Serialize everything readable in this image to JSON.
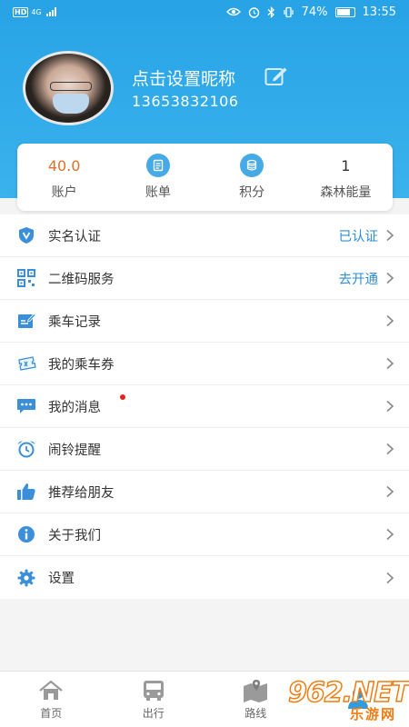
{
  "status_bar": {
    "network_hd": "HD",
    "network_gen": "4G",
    "battery": "74%",
    "time": "13:55"
  },
  "profile": {
    "nickname": "点击设置昵称",
    "phone": "13653832106"
  },
  "stats": [
    {
      "value": "40.0",
      "label": "账户",
      "icon": "value-text"
    },
    {
      "value": "",
      "label": "账单",
      "icon": "bill-icon"
    },
    {
      "value": "",
      "label": "积分",
      "icon": "coins-icon"
    },
    {
      "value": "1",
      "label": "森林能量",
      "icon": "value-text"
    }
  ],
  "menu": [
    {
      "label": "实名认证",
      "status": "已认证",
      "icon": "shield-v-icon"
    },
    {
      "label": "二维码服务",
      "status": "去开通",
      "icon": "qrcode-icon"
    },
    {
      "label": "乘车记录",
      "status": "",
      "icon": "record-icon"
    },
    {
      "label": "我的乘车券",
      "status": "",
      "icon": "ticket-icon"
    },
    {
      "label": "我的消息",
      "status": "",
      "icon": "message-icon",
      "badge": true
    },
    {
      "label": "闹铃提醒",
      "status": "",
      "icon": "alarm-icon"
    },
    {
      "label": "推荐给朋友",
      "status": "",
      "icon": "thumbs-up-icon"
    },
    {
      "label": "关于我们",
      "status": "",
      "icon": "info-icon"
    },
    {
      "label": "设置",
      "status": "",
      "icon": "gear-icon"
    }
  ],
  "tabbar": [
    {
      "label": "首页",
      "icon": "home-icon"
    },
    {
      "label": "出行",
      "icon": "bus-icon"
    },
    {
      "label": "路线",
      "icon": "map-icon"
    },
    {
      "label": "",
      "icon": "profile-icon"
    }
  ],
  "watermark": {
    "main": "962.NET",
    "sub": "乐游网"
  },
  "colors": {
    "header_blue": "#27a3e6",
    "accent_blue": "#2f8ed6",
    "orange": "#e0702a",
    "badge_red": "#e52222",
    "icon_blue": "#45aae6"
  }
}
